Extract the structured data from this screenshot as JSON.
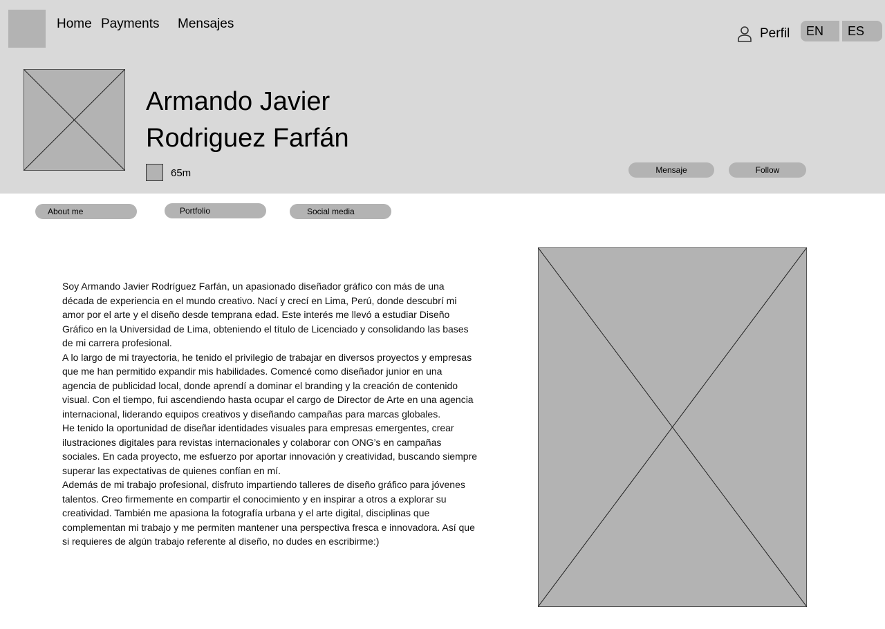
{
  "nav": {
    "links": [
      "Home",
      "Payments",
      "Mensajes"
    ],
    "profile_label": "Perfil",
    "languages": [
      "EN",
      "ES"
    ]
  },
  "profile": {
    "name_line1": "Armando Javier",
    "name_line2": "Rodriguez Farfán",
    "distance": "65m",
    "message_button": "Mensaje",
    "follow_button": "Follow"
  },
  "tabs": [
    "About me",
    "Portfolio",
    "Social media"
  ],
  "bio": {
    "paragraphs": [
      "Soy Armando Javier Rodríguez Farfán, un apasionado diseñador gráfico con más de una década de experiencia en el mundo creativo. Nací y crecí en Lima, Perú, donde descubrí mi amor por el arte y el diseño desde temprana edad. Este interés me llevó a estudiar Diseño Gráfico en la Universidad de Lima, obteniendo el título de Licenciado y consolidando las bases de mi carrera profesional.",
      "A lo largo de mi trayectoria, he tenido el privilegio de trabajar en diversos proyectos y empresas que me han permitido expandir mis habilidades. Comencé como diseñador junior en una agencia de publicidad local, donde aprendí a dominar el branding y la creación de contenido visual. Con el tiempo, fui ascendiendo hasta ocupar el cargo de Director de Arte en una agencia internacional, liderando equipos creativos y diseñando campañas para marcas globales.",
      "He tenido la oportunidad de diseñar identidades visuales para empresas emergentes, crear ilustraciones digitales para revistas internacionales y colaborar con ONG’s en campañas sociales. En cada proyecto, me esfuerzo por aportar innovación y creatividad, buscando siempre superar las expectativas de quienes confían en mí.",
      "Además de mi trabajo profesional, disfruto impartiendo talleres de diseño gráfico para jóvenes talentos. Creo firmemente en compartir el conocimiento y en inspirar a otros a explorar su creatividad. También me apasiona la fotografía urbana y el arte digital, disciplinas que complementan mi trabajo y me permiten mantener una perspectiva fresca e innovadora. Así que si requieres de algún trabajo referente al diseño, no dudes en escribirme:)"
    ]
  },
  "colors": {
    "header_bg": "#d9d9d9",
    "placeholder": "#b3b3b3",
    "page_bg": "#ffffff"
  }
}
